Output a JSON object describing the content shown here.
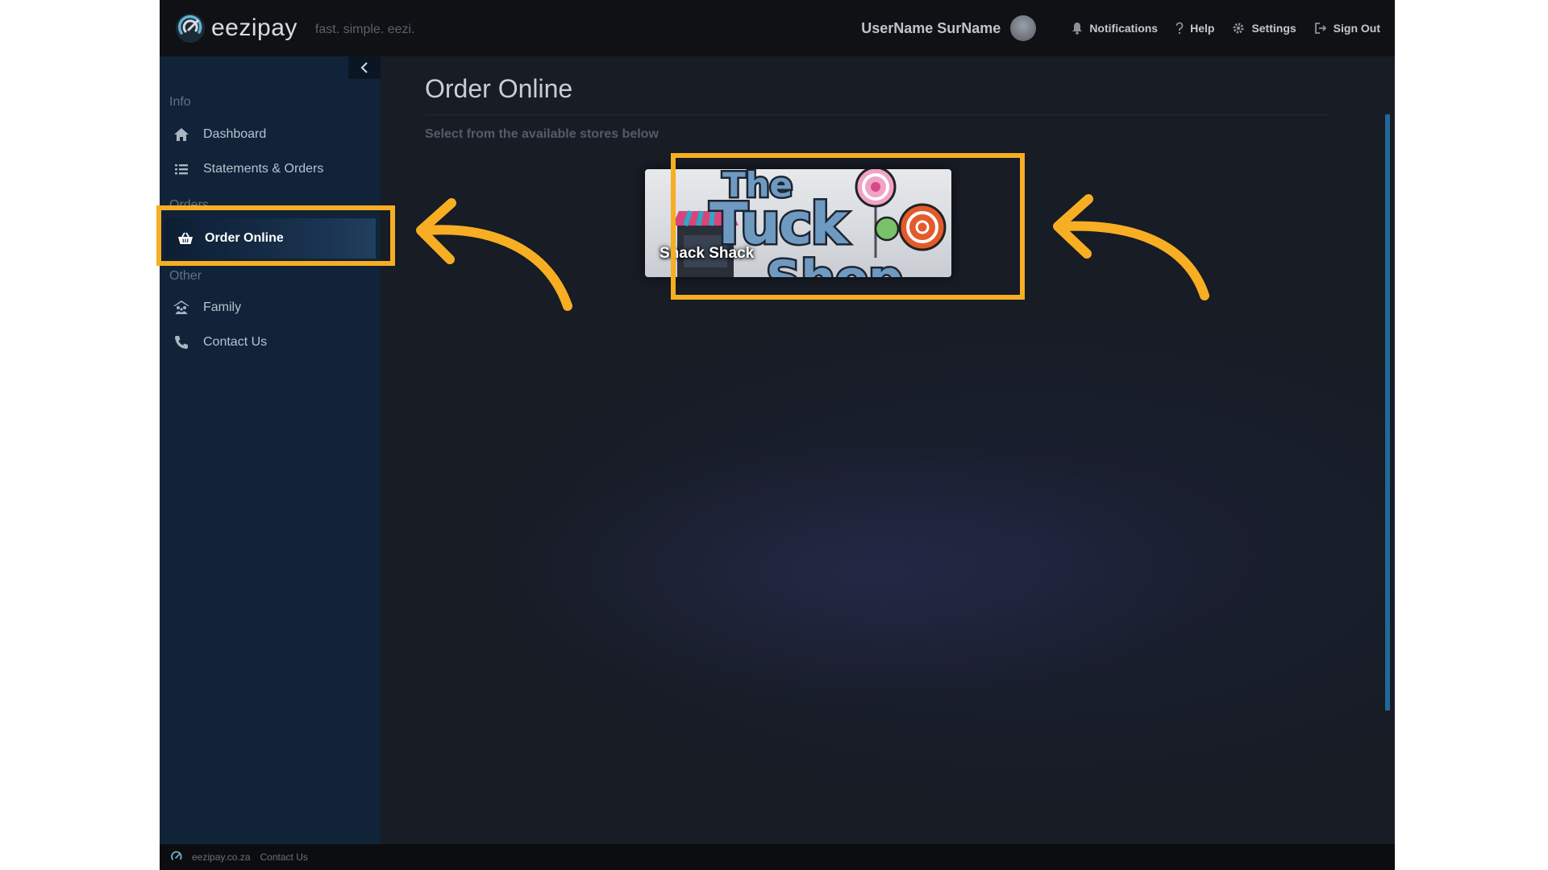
{
  "brand": {
    "name": "eezipay",
    "tagline": "fast. simple. eezi."
  },
  "topbar": {
    "username": "UserName SurName",
    "links": [
      {
        "label": "Notifications",
        "icon": "bell-icon"
      },
      {
        "label": "Help",
        "icon": "question-icon"
      },
      {
        "label": "Settings",
        "icon": "gear-icon"
      },
      {
        "label": "Sign Out",
        "icon": "sign-out-icon"
      }
    ]
  },
  "sidebar": {
    "sections": [
      {
        "label": "Info",
        "items": [
          {
            "label": "Dashboard",
            "icon": "home-icon"
          },
          {
            "label": "Statements & Orders",
            "icon": "list-icon"
          }
        ]
      },
      {
        "label": "Orders",
        "items": [
          {
            "label": "Order Online",
            "icon": "basket-icon",
            "active": true
          }
        ]
      },
      {
        "label": "Other",
        "items": [
          {
            "label": "Family",
            "icon": "family-icon"
          },
          {
            "label": "Contact Us",
            "icon": "phone-icon"
          }
        ]
      }
    ]
  },
  "main": {
    "title": "Order Online",
    "subtitle": "Select from the available stores below",
    "stores": [
      {
        "name": "Snack Shack",
        "logo_text": "The Tuck Shop"
      }
    ]
  },
  "footer": {
    "site": "eezipay.co.za",
    "contact": "Contact Us"
  },
  "annotation_color": "#f7ae23"
}
